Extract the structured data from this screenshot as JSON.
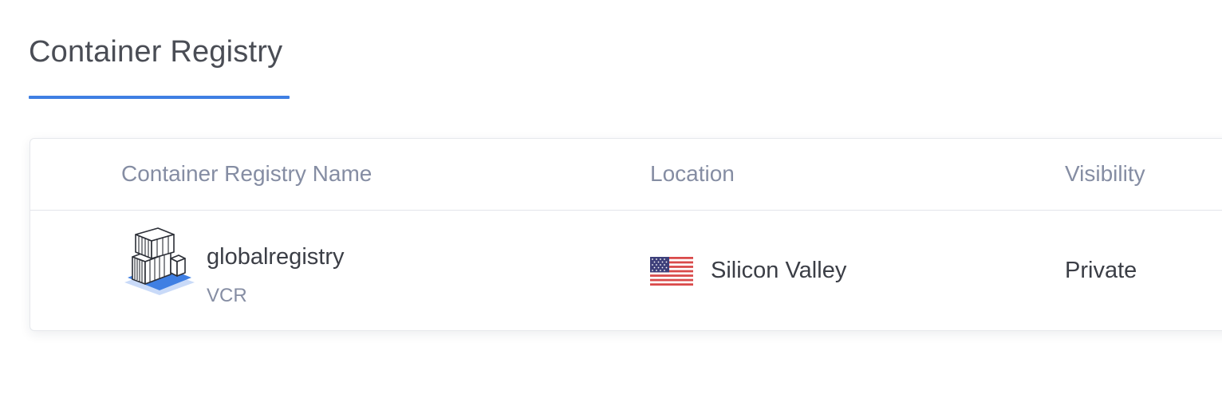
{
  "page": {
    "title": "Container Registry"
  },
  "table": {
    "columns": {
      "name": "Container Registry Name",
      "location": "Location",
      "visibility": "Visibility"
    },
    "rows": [
      {
        "name": "globalregistry",
        "type": "VCR",
        "icon": "container-registry-icon",
        "location": "Silicon Valley",
        "location_flag": "us-flag-icon",
        "visibility": "Private"
      }
    ]
  },
  "colors": {
    "accent": "#3f7fe3",
    "title_text": "#4a4d55",
    "header_text": "#858da3",
    "body_text": "#3b3e46"
  }
}
